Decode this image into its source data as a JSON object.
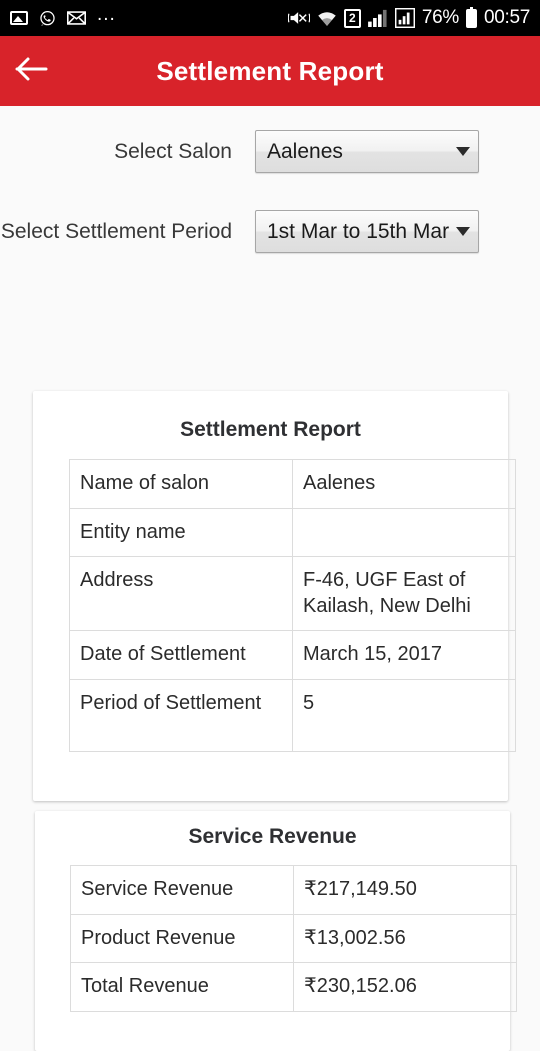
{
  "status_bar": {
    "left_icons": [
      "photo-icon",
      "whatsapp-icon",
      "mail-icon",
      "more-icon"
    ],
    "more": "...",
    "right_icons": [
      "vibrate-mute-icon",
      "wifi-icon",
      "sim2-icon",
      "signal-icon",
      "signal-2-icon"
    ],
    "sim_label": "2",
    "battery_percent": "76%",
    "time": "00:57"
  },
  "appbar": {
    "back_icon": "back-arrow-icon",
    "title": "Settlement Report",
    "color": "#d8232a"
  },
  "form": {
    "salon": {
      "label": "Select Salon",
      "selected": "Aalenes"
    },
    "period": {
      "label": "Select Settlement Period",
      "selected": "1st Mar to 15th Mar"
    }
  },
  "report_card": {
    "title": "Settlement Report",
    "rows": [
      {
        "key": "Name of salon",
        "value": "Aalenes"
      },
      {
        "key": "Entity name",
        "value": ""
      },
      {
        "key": "Address",
        "value": "F-46, UGF East of Kailash, New Delhi"
      },
      {
        "key": "Date of Settlement",
        "value": "March 15, 2017"
      },
      {
        "key": "Period of Settlement",
        "value": "5"
      }
    ]
  },
  "revenue_card": {
    "title": "Service Revenue",
    "rows": [
      {
        "key": "Service Revenue",
        "value": "₹217,149.50"
      },
      {
        "key": "Product Revenue",
        "value": "₹13,002.56"
      },
      {
        "key": "Total Revenue",
        "value": "₹230,152.06"
      }
    ]
  }
}
